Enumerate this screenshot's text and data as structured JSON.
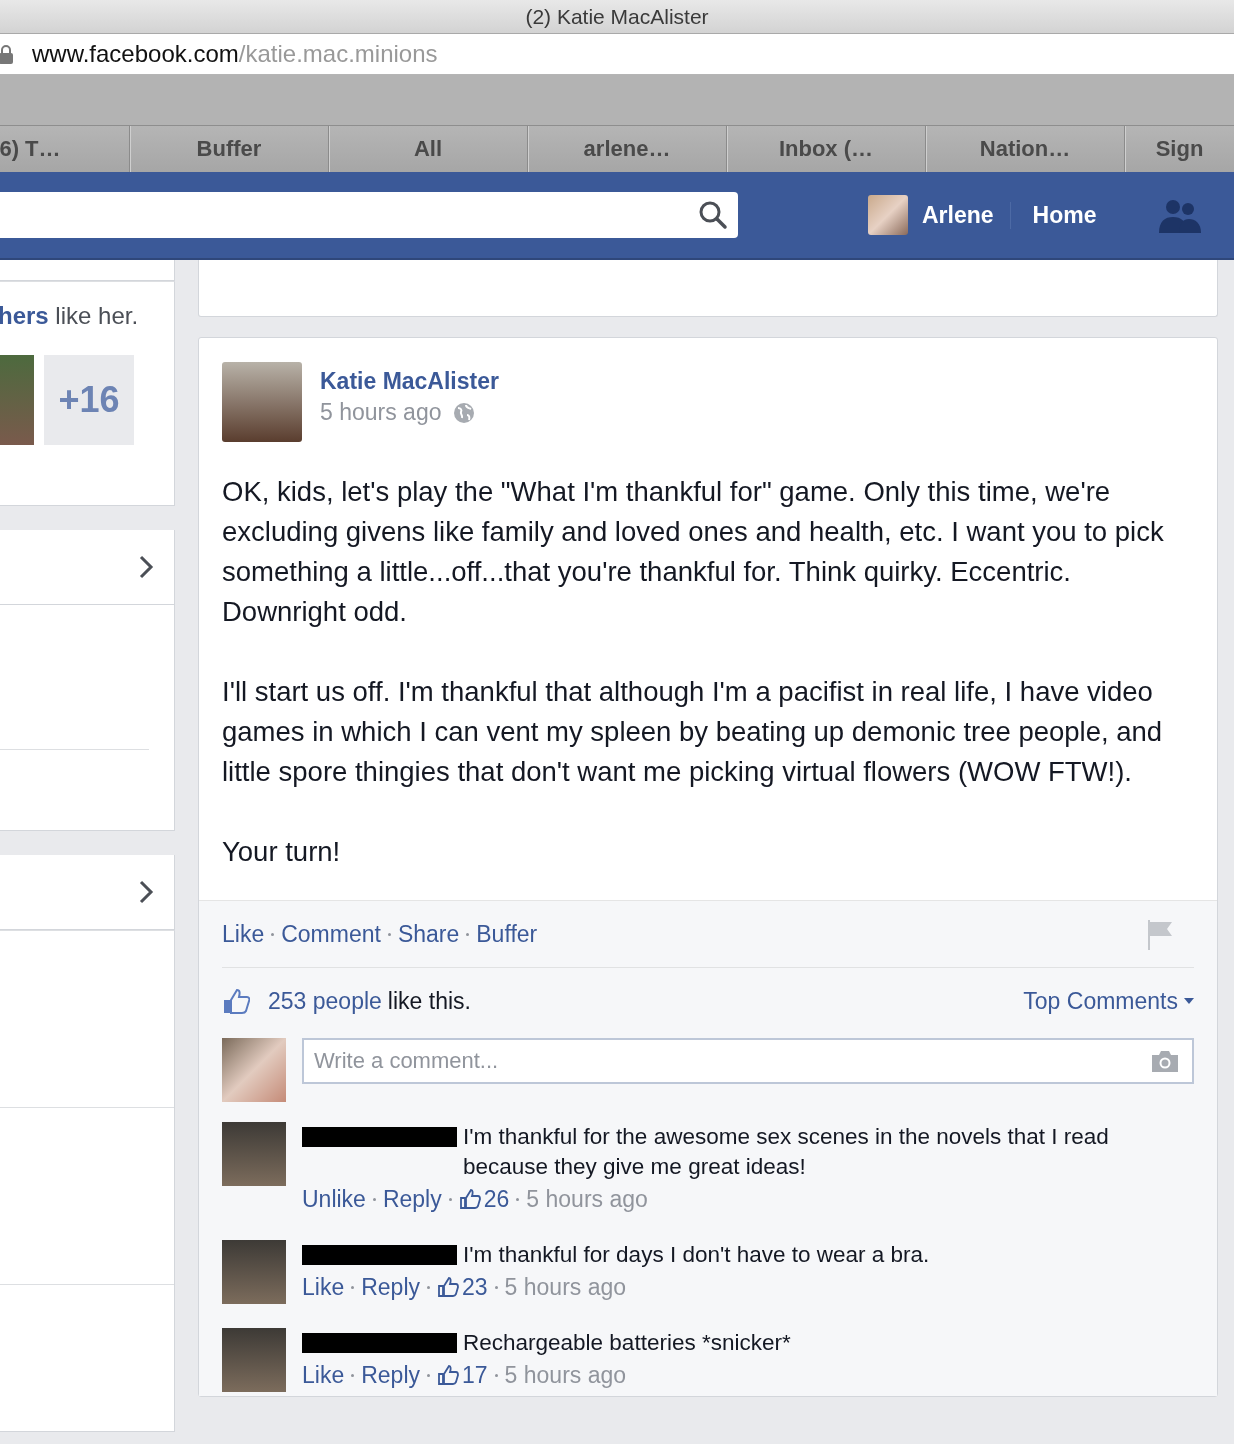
{
  "browser": {
    "title": "(2) Katie MacAlister",
    "url_host": "www.facebook.com",
    "url_path": "/katie.mac.minions",
    "tabs": [
      "6) T…",
      "Buffer",
      "All",
      "arlene…",
      "Inbox (…",
      "Nation…",
      "Sign"
    ]
  },
  "top_bar": {
    "profile_name": "Arlene",
    "home": "Home"
  },
  "sidebar": {
    "likes_text": "**hers** like her.",
    "more_count": "+16"
  },
  "post": {
    "author": "Katie MacAlister",
    "time": "5 hours ago",
    "paragraphs": [
      "OK, kids, let's play the \"What I'm thankful for\" game. Only this time, we're excluding givens like family and loved ones and health, etc. I want you to pick something a little...off...that you're thankful for. Think quirky. Eccentric. Downright odd.",
      "I'll start us off. I'm thankful that although I'm a pacifist in real life, I have video games in which I can vent my spleen by beating up demonic tree people, and little spore thingies that don't want me picking virtual flowers (WOW FTW!).",
      "Your turn!"
    ],
    "actions": [
      "Like",
      "Comment",
      "Share",
      "Buffer"
    ],
    "likes_link": "253 people",
    "likes_text": "like this.",
    "sort": "Top Comments",
    "comment_box": {
      "placeholder": "Write a comment..."
    },
    "comments": [
      {
        "text": "I'm thankful for the awesome sex scenes in the novels that I read because they give me great ideas!",
        "like_action": "Unlike",
        "reply": "Reply",
        "likes": "26",
        "time": "5 hours ago"
      },
      {
        "text": "I'm thankful for days I don't have to wear a bra.",
        "like_action": "Like",
        "reply": "Reply",
        "likes": "23",
        "time": "5 hours ago"
      },
      {
        "text": "Rechargeable batteries *snicker*",
        "like_action": "Like",
        "reply": "Reply",
        "likes": "17",
        "time": "5 hours ago"
      }
    ]
  }
}
